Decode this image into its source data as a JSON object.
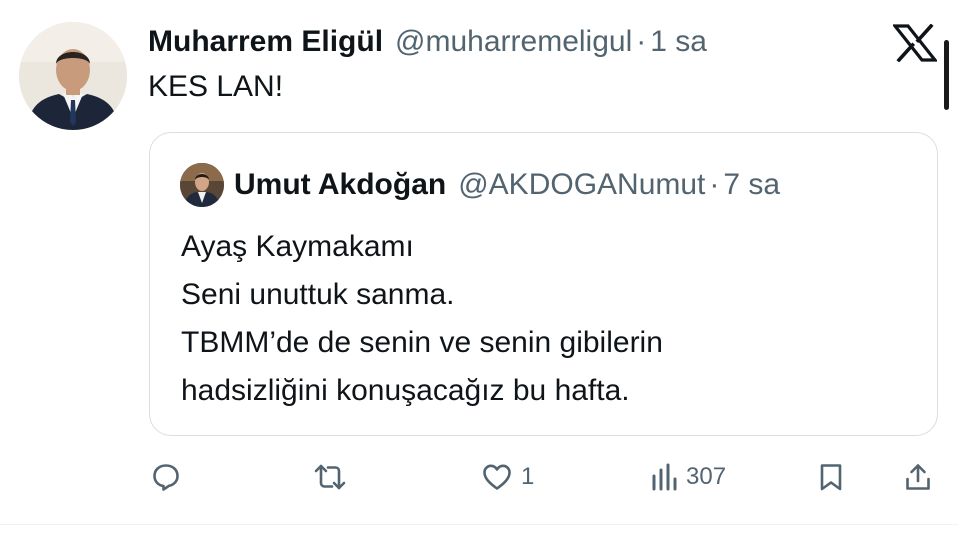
{
  "tweet": {
    "author_name": "Muharrem Eligül",
    "author_handle": "@muharremeligul",
    "separator": "·",
    "time": "1 sa",
    "text": "KES LAN!",
    "avatar_icon": "person-photo-avatar"
  },
  "quoted_tweet": {
    "author_name": "Umut Akdoğan",
    "author_handle": "@AKDOGANumut",
    "separator": "·",
    "time": "7 sa",
    "lines": [
      "Ayaş Kaymakamı",
      "Seni unuttuk sanma.",
      "TBMM’de de senin ve senin gibilerin",
      "hadsizliğini konuşacağız bu hafta."
    ],
    "avatar_icon": "person-photo-avatar"
  },
  "actions": {
    "reply": {
      "icon": "reply-icon"
    },
    "retweet": {
      "icon": "retweet-icon"
    },
    "like": {
      "icon": "heart-icon",
      "count": "1"
    },
    "views": {
      "icon": "views-chart-icon",
      "count": "307"
    },
    "bookmark": {
      "icon": "bookmark-icon"
    },
    "share": {
      "icon": "share-icon"
    }
  },
  "brand": {
    "logo": "x-logo-icon"
  },
  "colors": {
    "text": "#0f1419",
    "secondary": "#536471",
    "border": "#d8dee3"
  }
}
